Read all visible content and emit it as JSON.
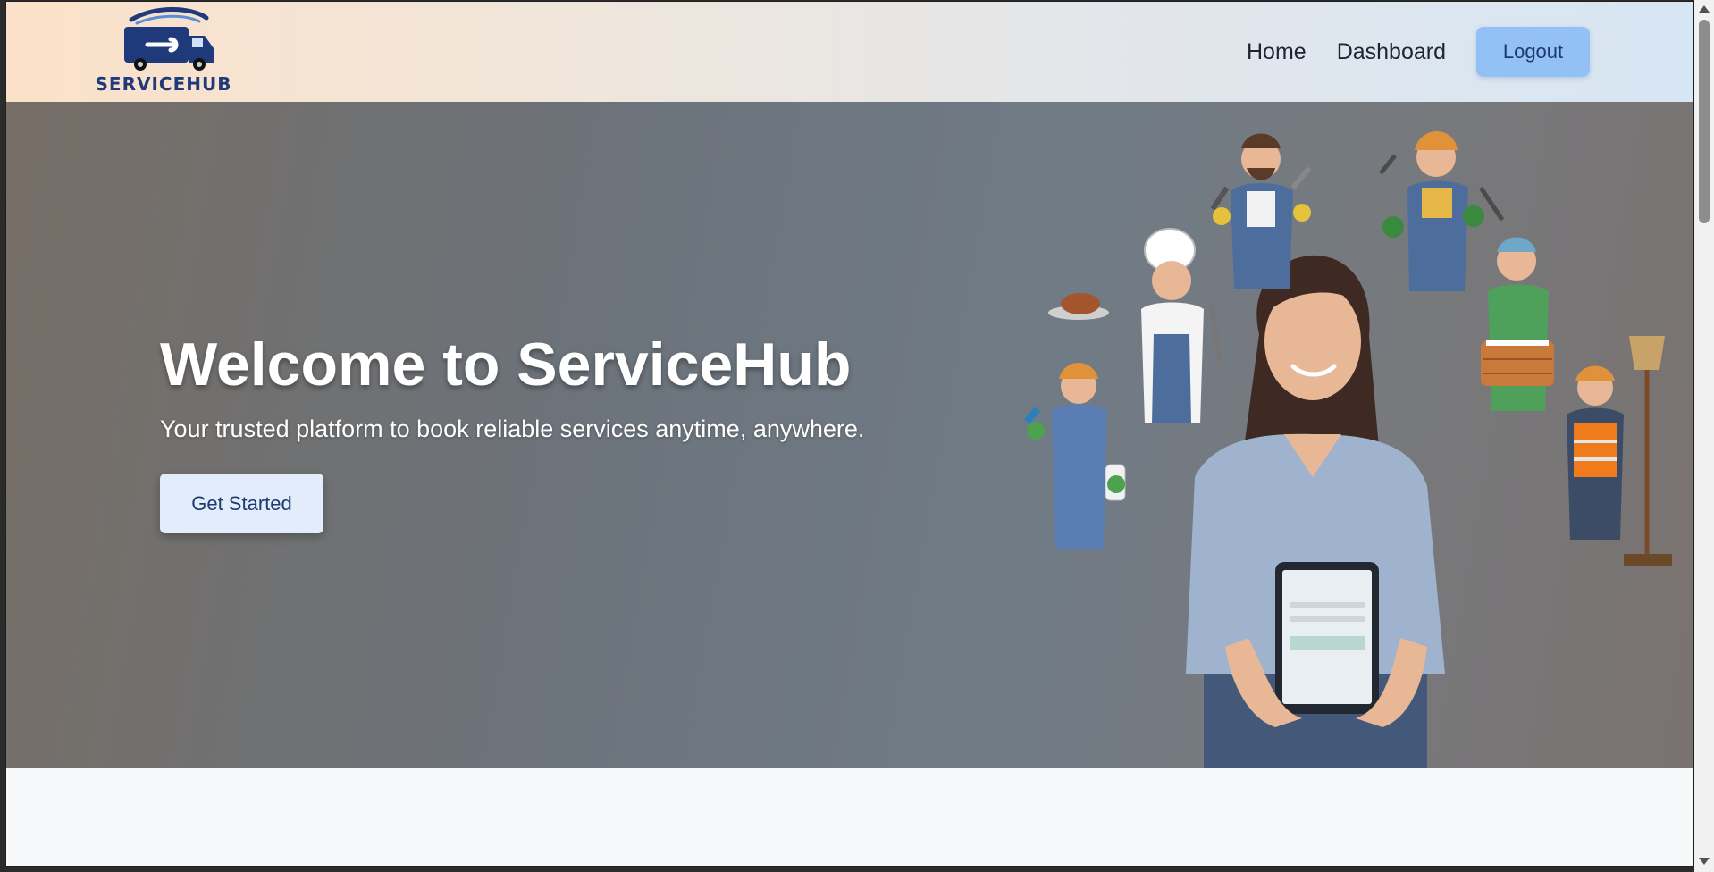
{
  "brand": {
    "name": "SERVICEHUB",
    "logo_icon": "truck-wrench-icon",
    "color": "#1e3a7b"
  },
  "nav": {
    "home_label": "Home",
    "dashboard_label": "Dashboard",
    "logout_label": "Logout"
  },
  "hero": {
    "title": "Welcome to ServiceHub",
    "subtitle": "Your trusted platform to book reliable services anytime, anywhere.",
    "cta_label": "Get Started",
    "illustration": "service-workers-illustration"
  },
  "colors": {
    "logout_bg": "#93c1f6",
    "cta_bg": "#e3ecfb",
    "nav_gradient_start": "#fbe1c9",
    "nav_gradient_end": "#d7e6f4"
  }
}
